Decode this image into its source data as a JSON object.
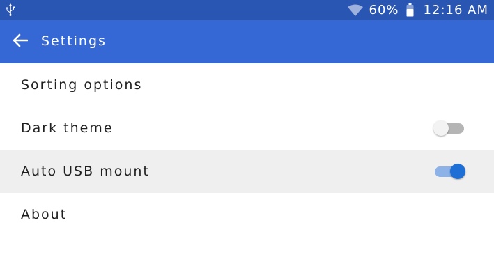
{
  "status_bar": {
    "battery_percent": "60%",
    "time": "12:16 AM",
    "icons": [
      "usb-icon",
      "wifi-icon",
      "battery-icon"
    ]
  },
  "app_bar": {
    "title": "Settings",
    "back_icon": "arrow-left-icon"
  },
  "settings": {
    "items": [
      {
        "label": "Sorting options"
      },
      {
        "label": "Dark theme",
        "toggle": false
      },
      {
        "label": "Auto USB mount",
        "toggle": true
      },
      {
        "label": "About"
      }
    ]
  },
  "colors": {
    "status_bar": "#2a56b3",
    "app_bar": "#3568d4",
    "toggle_on": "#1d6fd6",
    "highlight_row": "#efefef"
  }
}
